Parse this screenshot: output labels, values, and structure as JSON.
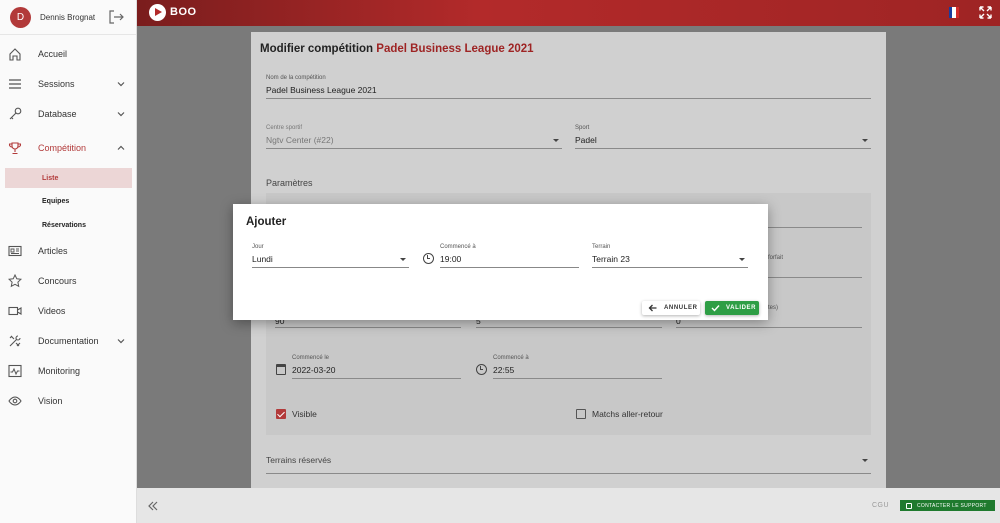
{
  "user": {
    "initial": "D",
    "name": "Dennis Brognat"
  },
  "app": {
    "name": "BOO"
  },
  "sidebar": {
    "items": [
      {
        "label": "Accueil"
      },
      {
        "label": "Sessions"
      },
      {
        "label": "Database"
      },
      {
        "label": "Compétition"
      },
      {
        "label": "Articles"
      },
      {
        "label": "Concours"
      },
      {
        "label": "Videos"
      },
      {
        "label": "Documentation"
      },
      {
        "label": "Monitoring"
      },
      {
        "label": "Vision"
      }
    ],
    "subitems": [
      {
        "label": "Liste"
      },
      {
        "label": "Equipes"
      },
      {
        "label": "Réservations"
      }
    ]
  },
  "page": {
    "title_prefix": "Modifier compétition",
    "title_name": "Padel Business League 2021",
    "competition_name_label": "Nom de la compétition",
    "competition_name_value": "Padel Business League 2021",
    "center_label": "Centre sportif",
    "center_value": "Ngtv Center (#22)",
    "sport_label": "Sport",
    "sport_value": "Padel",
    "params_title": "Paramètres",
    "forfait_label": "forfait",
    "minutes_label": "tes)",
    "val_a": "90",
    "val_b": "5",
    "val_c": "0",
    "start_date_label": "Commencé le",
    "start_date_value": "2022-03-20",
    "start_time_label": "Commencé à",
    "start_time_value": "22:55",
    "visible_label": "Visible",
    "matchs_label": "Matchs aller-retour",
    "reserved_fields_label": "Terrains réservés"
  },
  "footer": {
    "cgu": "CGU",
    "support": "CONTACTER LE SUPPORT"
  },
  "dialog": {
    "title": "Ajouter",
    "day_label": "Jour",
    "day_value": "Lundi",
    "time_label": "Commencé à",
    "time_value": "19:00",
    "field_label": "Terrain",
    "field_value": "Terrain 23",
    "cancel": "ANNULER",
    "ok": "VALIDER"
  },
  "colors": {
    "brand": "#b23a3a",
    "success": "#2e9e45",
    "support": "#1f7a2e"
  },
  "icons": [
    "logout-icon",
    "home-icon",
    "menu-icon",
    "key-icon",
    "trophy-icon",
    "newspaper-icon",
    "star-icon",
    "video-icon",
    "tools-icon",
    "monitoring-icon",
    "eye-icon",
    "chevron-down-icon",
    "chevron-up-icon",
    "fullscreen-icon",
    "clock-icon",
    "calendar-icon",
    "arrow-left-icon",
    "check-icon",
    "double-chevron-left-icon",
    "flag-icon"
  ]
}
